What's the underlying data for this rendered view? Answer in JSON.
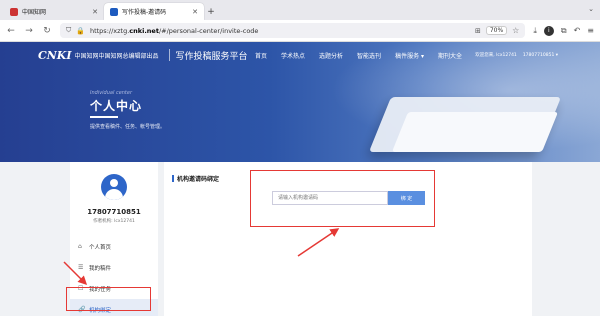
{
  "browser": {
    "tabs": [
      {
        "title": "中国知网",
        "active": false
      },
      {
        "title": "写作投稿-邀请码",
        "active": true
      }
    ],
    "url_prefix": "https://xztg.",
    "url_domain": "cnki.net",
    "url_path": "/#/personal-center/invite-code",
    "zoom": "70%"
  },
  "site": {
    "logo_mark": "CNKI",
    "logo_cn": "中国知网",
    "logo_sub": "中国知网总编辑部出品",
    "platform": "写作投稿服务平台",
    "nav": [
      "首页",
      "学术热点",
      "选题分析",
      "智能选刊",
      "稿件服务 ▾",
      "期刊大全"
    ],
    "user_welcome": "欢迎您来, lcx12741",
    "user_phone": "17807710851 ▾"
  },
  "hero": {
    "en": "Individual center",
    "title": "个人中心",
    "desc": "提供查看稿件、任务、帐号管理。"
  },
  "sidebar": {
    "username": "17807710851",
    "org": "作者机构: lcx12741",
    "items": [
      {
        "icon": "⌂",
        "label": "个人首页",
        "active": false
      },
      {
        "icon": "☰",
        "label": "我的稿件",
        "active": false
      },
      {
        "icon": "☐",
        "label": "我的任务",
        "active": false
      },
      {
        "icon": "🔗",
        "label": "机构绑定",
        "active": true
      }
    ]
  },
  "main": {
    "section_title": "机构邀请码绑定",
    "input_placeholder": "请输入机构邀请码",
    "bind_label": "绑 定"
  },
  "colors": {
    "accent": "#2e66c9",
    "annotation": "#e53935",
    "button": "#5a8fe0"
  }
}
